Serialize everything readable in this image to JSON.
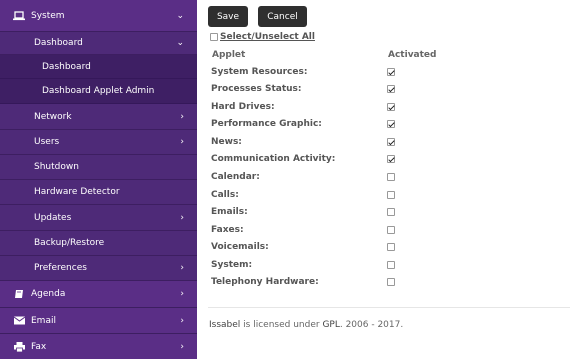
{
  "sidebar": {
    "system": {
      "label": "System",
      "icon": "laptop-icon"
    },
    "dashboard": {
      "label": "Dashboard"
    },
    "dashboard_sub": {
      "label": "Dashboard"
    },
    "dashboard_applet_admin": {
      "label": "Dashboard Applet Admin"
    },
    "network": {
      "label": "Network"
    },
    "users": {
      "label": "Users"
    },
    "shutdown": {
      "label": "Shutdown"
    },
    "hardware_detector": {
      "label": "Hardware Detector"
    },
    "updates": {
      "label": "Updates"
    },
    "backup_restore": {
      "label": "Backup/Restore"
    },
    "preferences": {
      "label": "Preferences"
    },
    "agenda": {
      "label": "Agenda",
      "icon": "book-icon"
    },
    "email": {
      "label": "Email",
      "icon": "envelope-icon"
    },
    "fax": {
      "label": "Fax",
      "icon": "printer-icon"
    }
  },
  "toolbar": {
    "save_label": "Save",
    "cancel_label": "Cancel"
  },
  "select_all_label": "Select/Unselect All",
  "table": {
    "col_applet": "Applet",
    "col_activated": "Activated",
    "rows": [
      {
        "label": "System Resources:",
        "checked": true
      },
      {
        "label": "Processes Status:",
        "checked": true
      },
      {
        "label": "Hard Drives:",
        "checked": true
      },
      {
        "label": "Performance Graphic:",
        "checked": true
      },
      {
        "label": "News:",
        "checked": true
      },
      {
        "label": "Communication Activity:",
        "checked": true
      },
      {
        "label": "Calendar:",
        "checked": false
      },
      {
        "label": "Calls:",
        "checked": false
      },
      {
        "label": "Emails:",
        "checked": false
      },
      {
        "label": "Faxes:",
        "checked": false
      },
      {
        "label": "Voicemails:",
        "checked": false
      },
      {
        "label": "System:",
        "checked": false
      },
      {
        "label": "Telephony Hardware:",
        "checked": false
      }
    ]
  },
  "footer": {
    "brand": "Issabel",
    "text1": " is licensed under ",
    "license": "GPL",
    "text2": ". 2006 - 2017."
  },
  "colors": {
    "sidebar": "#4a2673",
    "button": "#2f2f2f"
  }
}
